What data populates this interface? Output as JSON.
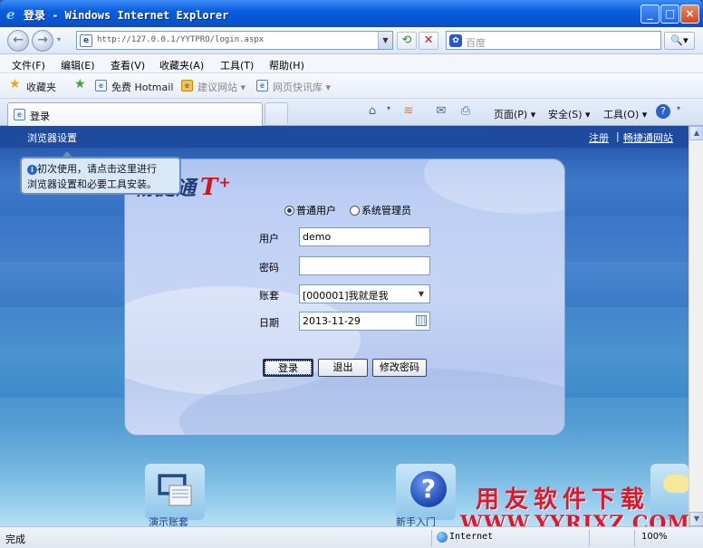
{
  "window": {
    "title": "登录 - Windows Internet Explorer",
    "buttons": {
      "minimize": "_",
      "maximize": "□",
      "close": "×"
    }
  },
  "address": {
    "url": "http://127.0.0.1/YYTPRO/login.aspx",
    "search_placeholder": "百度",
    "search_button": "🔍▾"
  },
  "menu": [
    "文件(F)",
    "编辑(E)",
    "查看(V)",
    "收藏夹(A)",
    "工具(T)",
    "帮助(H)"
  ],
  "favorites": {
    "label": "收藏夹",
    "items": [
      "免费 Hotmail",
      "建议网站 ▾",
      "网页快讯库 ▾"
    ]
  },
  "tabs": {
    "active": "登录"
  },
  "command_bar": [
    "页面(P) ▾",
    "安全(S) ▾",
    "工具(O) ▾"
  ],
  "page": {
    "browser_settings": "浏览器设置",
    "register": "注册",
    "separator": "|",
    "site": "畅捷通网站",
    "tooltip_line1": "初次使用，请点击这里进行",
    "tooltip_line2": "浏览器设置和必要工具安装。"
  },
  "login": {
    "logo_text": "畅捷通",
    "logo_t": "T",
    "logo_plus": "+",
    "radio_user": "普通用户",
    "radio_admin": "系统管理员",
    "selected_role": "普通用户",
    "user_label": "用户",
    "user_value": "demo",
    "password_label": "密码",
    "password_value": "",
    "account_label": "账套",
    "account_value": "[000001]我就是我",
    "date_label": "日期",
    "date_value": "2013-11-29",
    "login_button": "登录",
    "exit_button": "退出",
    "change_password_button": "修改密码"
  },
  "bottom": {
    "label1": "新手入门",
    "label2": "演示账套"
  },
  "watermark": {
    "cn": "用友软件下载",
    "en": "WWW.YYRJXZ.COM"
  },
  "status": {
    "text": "完成",
    "zone": "Internet",
    "zoom": "100%"
  }
}
